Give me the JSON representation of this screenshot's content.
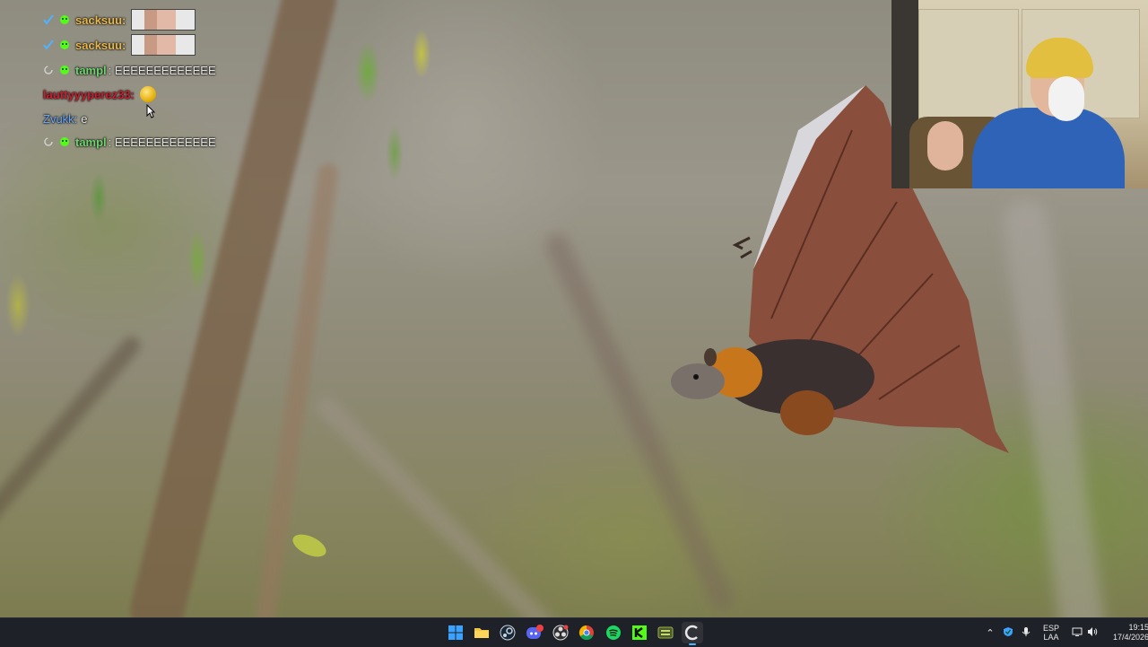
{
  "chat": {
    "messages": [
      {
        "user": "sacksuu:",
        "text": "",
        "user_color": "#e8b94a",
        "has_image": true
      },
      {
        "user": "sacksuu:",
        "text": "",
        "user_color": "#e8b94a",
        "has_image": true
      },
      {
        "user": "tampl",
        "text": ": EEEEEEEEEEEEE",
        "user_color": "#6fd36f"
      },
      {
        "user": "lauttyyyperez33:",
        "text": "",
        "user_color": "#c81e2e",
        "has_emote": true
      },
      {
        "user": "Zvukk:",
        "text": "e",
        "user_color": "#6aa8ff"
      },
      {
        "user": "tampl",
        "text": ": EEEEEEEEEEEEE",
        "user_color": "#6fd36f"
      }
    ]
  },
  "taskbar": {
    "apps": [
      {
        "name": "windows-start",
        "icon": "windows-logo-icon"
      },
      {
        "name": "file-explorer",
        "icon": "folder-icon"
      },
      {
        "name": "steam",
        "icon": "steam-icon"
      },
      {
        "name": "discord",
        "icon": "discord-icon"
      },
      {
        "name": "obs",
        "icon": "obs-icon"
      },
      {
        "name": "chrome",
        "icon": "chrome-icon"
      },
      {
        "name": "spotify",
        "icon": "spotify-icon"
      },
      {
        "name": "kick",
        "icon": "kick-icon"
      },
      {
        "name": "app",
        "icon": "game-icon"
      },
      {
        "name": "app",
        "icon": "c-icon"
      }
    ],
    "tray": {
      "lang_top": "ESP",
      "lang_bottom": "LAA",
      "time": "19:15",
      "date": "17/4/2026"
    }
  },
  "colors": {
    "taskbar_bg": "#1f2128",
    "accent": "#0078d4"
  }
}
